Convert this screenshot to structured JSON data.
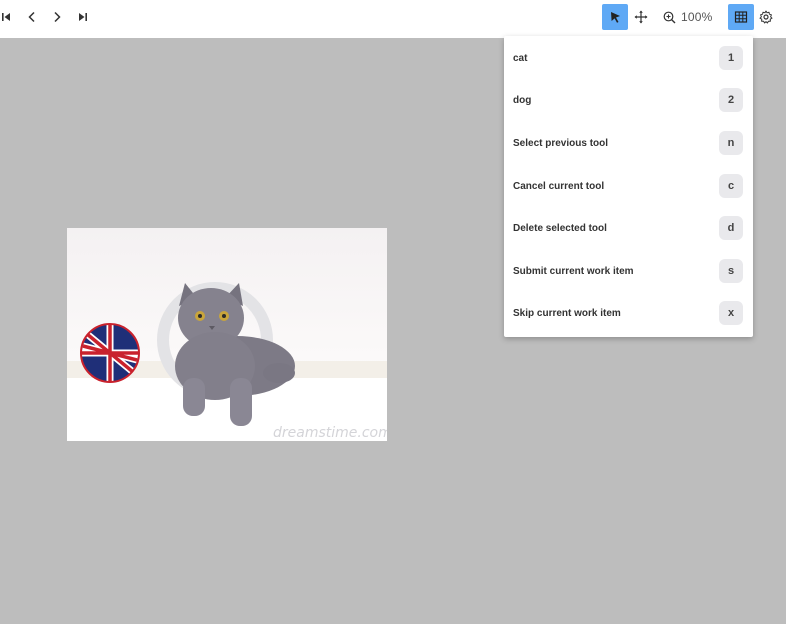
{
  "toolbar": {
    "zoom_label": "100%",
    "icons": [
      "first-page-icon",
      "previous-icon",
      "next-icon",
      "last-page-icon",
      "select-cursor-icon",
      "move-icon",
      "zoom-in-icon",
      "grid-icon",
      "gear-icon"
    ],
    "active_color": "#5fa9f5"
  },
  "image": {
    "watermark": "dreamstime.com"
  },
  "menu": {
    "items": [
      {
        "label": "cat",
        "key": "1"
      },
      {
        "label": "dog",
        "key": "2"
      },
      {
        "label": "Select previous tool",
        "key": "n"
      },
      {
        "label": "Cancel current tool",
        "key": "c"
      },
      {
        "label": "Delete selected tool",
        "key": "d"
      },
      {
        "label": "Submit current work item",
        "key": "s"
      },
      {
        "label": "Skip current work item",
        "key": "x"
      }
    ]
  }
}
